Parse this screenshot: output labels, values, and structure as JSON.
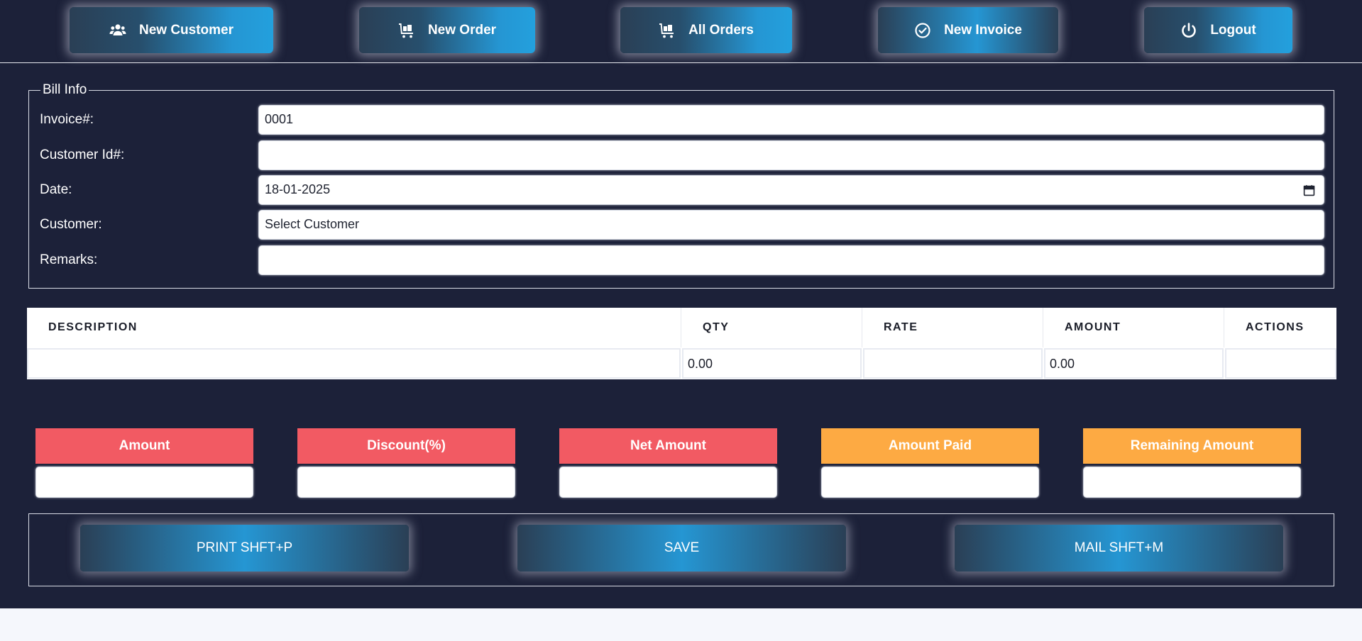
{
  "nav": {
    "new_customer": "New Customer",
    "new_order": "New Order",
    "all_orders": "All Orders",
    "new_invoice": "New Invoice",
    "logout": "Logout"
  },
  "bill_info": {
    "legend": "Bill Info",
    "invoice_label": "Invoice#:",
    "invoice_value": "0001",
    "customer_id_label": "Customer Id#:",
    "customer_id_value": "",
    "date_label": "Date:",
    "date_value": "18-01-2025",
    "customer_label": "Customer:",
    "customer_value": "Select Customer",
    "remarks_label": "Remarks:",
    "remarks_value": ""
  },
  "table": {
    "headers": [
      "DESCRIPTION",
      "QTY",
      "RATE",
      "AMOUNT",
      "ACTIONS"
    ],
    "row": {
      "description": "",
      "qty": "0.00",
      "rate": "",
      "amount": "0.00",
      "actions": ""
    }
  },
  "totals": {
    "amount": "Amount",
    "discount": "Discount(%)",
    "net_amount": "Net Amount",
    "amount_paid": "Amount Paid",
    "remaining_amount": "Remaining Amount"
  },
  "actions": {
    "print": "PRINT SHFT+P",
    "save": "SAVE",
    "mail": "MAIL SHFT+M"
  },
  "colors": {
    "background": "#1c2139",
    "accent_blue": "#2596d3",
    "label_red": "#f25a63",
    "label_orange": "#fdaa43"
  },
  "icons": {
    "new_customer": "users-icon",
    "new_order": "cart-icon",
    "all_orders": "cart-icon",
    "new_invoice": "check-circle-icon",
    "logout": "power-icon"
  }
}
